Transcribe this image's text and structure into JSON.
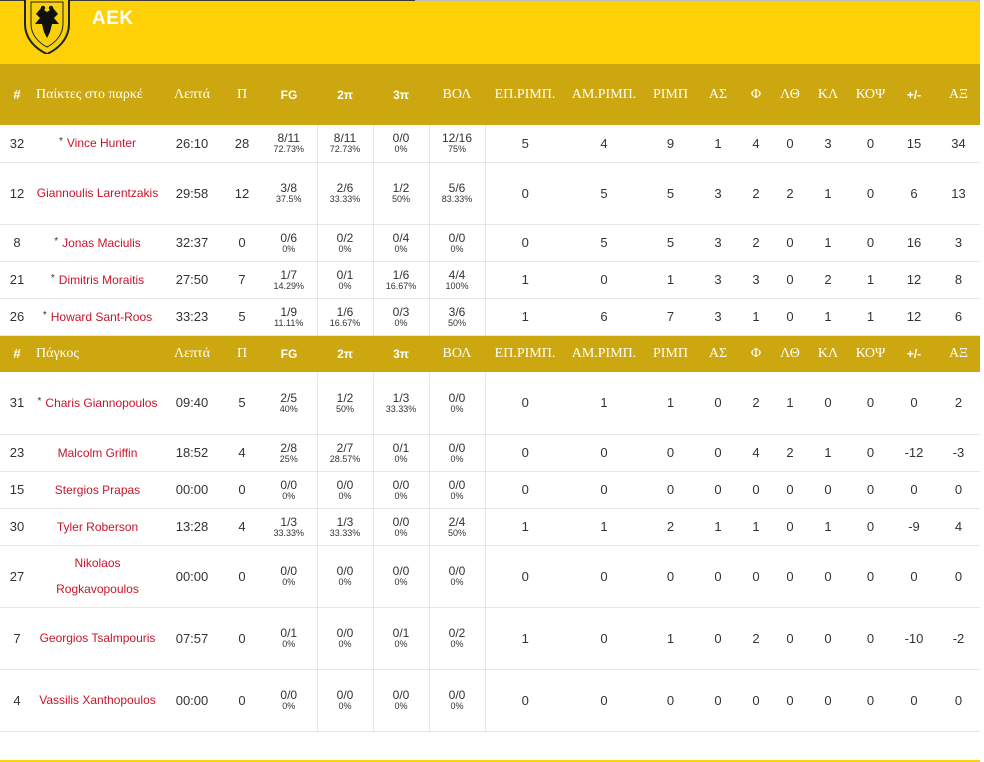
{
  "team": {
    "name": "ΑΕΚ",
    "logo_text": "ΑΕΚ"
  },
  "columns": [
    "Λεπτά",
    "Π",
    "FG",
    "2π",
    "3π",
    "ΒΟΛ",
    "ΕΠ.ΡΙΜΠ.",
    "ΑΜ.ΡΙΜΠ.",
    "ΡΙΜΠ",
    "ΑΣ",
    "Φ",
    "ΛΘ",
    "ΚΛ",
    "ΚΟΨ",
    "+/-",
    "ΑΞ"
  ],
  "starters": {
    "num_label": "#",
    "title": "Παίκτες στο παρκέ",
    "players": [
      {
        "num": "32",
        "starter": true,
        "name": "Vince Hunter",
        "min": "26:10",
        "pts": "28",
        "fg": "8/11",
        "fg_p": "72.73%",
        "p2": "8/11",
        "p2_p": "72.73%",
        "p3": "0/0",
        "p3_p": "0%",
        "ft": "12/16",
        "ft_p": "75%",
        "oreb": "5",
        "dreb": "4",
        "reb": "9",
        "ast": "1",
        "pf": "4",
        "to": "0",
        "stl": "3",
        "blk": "0",
        "pm": "15",
        "eff": "34"
      },
      {
        "num": "12",
        "starter": false,
        "name": "Giannoulis Larentzakis",
        "min": "29:58",
        "pts": "12",
        "fg": "3/8",
        "fg_p": "37.5%",
        "p2": "2/6",
        "p2_p": "33.33%",
        "p3": "1/2",
        "p3_p": "50%",
        "ft": "5/6",
        "ft_p": "83.33%",
        "oreb": "0",
        "dreb": "5",
        "reb": "5",
        "ast": "3",
        "pf": "2",
        "to": "2",
        "stl": "1",
        "blk": "0",
        "pm": "6",
        "eff": "13"
      },
      {
        "num": "8",
        "starter": true,
        "name": "Jonas Maciulis",
        "min": "32:37",
        "pts": "0",
        "fg": "0/6",
        "fg_p": "0%",
        "p2": "0/2",
        "p2_p": "0%",
        "p3": "0/4",
        "p3_p": "0%",
        "ft": "0/0",
        "ft_p": "0%",
        "oreb": "0",
        "dreb": "5",
        "reb": "5",
        "ast": "3",
        "pf": "2",
        "to": "0",
        "stl": "1",
        "blk": "0",
        "pm": "16",
        "eff": "3"
      },
      {
        "num": "21",
        "starter": true,
        "name": "Dimitris Moraitis",
        "min": "27:50",
        "pts": "7",
        "fg": "1/7",
        "fg_p": "14.29%",
        "p2": "0/1",
        "p2_p": "0%",
        "p3": "1/6",
        "p3_p": "16.67%",
        "ft": "4/4",
        "ft_p": "100%",
        "oreb": "1",
        "dreb": "0",
        "reb": "1",
        "ast": "3",
        "pf": "3",
        "to": "0",
        "stl": "2",
        "blk": "1",
        "pm": "12",
        "eff": "8"
      },
      {
        "num": "26",
        "starter": true,
        "name": "Howard Sant-Roos",
        "min": "33:23",
        "pts": "5",
        "fg": "1/9",
        "fg_p": "11.11%",
        "p2": "1/6",
        "p2_p": "16.67%",
        "p3": "0/3",
        "p3_p": "0%",
        "ft": "3/6",
        "ft_p": "50%",
        "oreb": "1",
        "dreb": "6",
        "reb": "7",
        "ast": "3",
        "pf": "1",
        "to": "0",
        "stl": "1",
        "blk": "1",
        "pm": "12",
        "eff": "6"
      }
    ]
  },
  "bench": {
    "num_label": "#",
    "title": "Πάγκος",
    "players": [
      {
        "num": "31",
        "starter": true,
        "name": "Charis Giannopoulos",
        "min": "09:40",
        "pts": "5",
        "fg": "2/5",
        "fg_p": "40%",
        "p2": "1/2",
        "p2_p": "50%",
        "p3": "1/3",
        "p3_p": "33.33%",
        "ft": "0/0",
        "ft_p": "0%",
        "oreb": "0",
        "dreb": "1",
        "reb": "1",
        "ast": "0",
        "pf": "2",
        "to": "1",
        "stl": "0",
        "blk": "0",
        "pm": "0",
        "eff": "2"
      },
      {
        "num": "23",
        "starter": false,
        "name": "Malcolm Griffin",
        "min": "18:52",
        "pts": "4",
        "fg": "2/8",
        "fg_p": "25%",
        "p2": "2/7",
        "p2_p": "28.57%",
        "p3": "0/1",
        "p3_p": "0%",
        "ft": "0/0",
        "ft_p": "0%",
        "oreb": "0",
        "dreb": "0",
        "reb": "0",
        "ast": "0",
        "pf": "4",
        "to": "2",
        "stl": "1",
        "blk": "0",
        "pm": "-12",
        "eff": "-3"
      },
      {
        "num": "15",
        "starter": false,
        "name": "Stergios Prapas",
        "min": "00:00",
        "pts": "0",
        "fg": "0/0",
        "fg_p": "0%",
        "p2": "0/0",
        "p2_p": "0%",
        "p3": "0/0",
        "p3_p": "0%",
        "ft": "0/0",
        "ft_p": "0%",
        "oreb": "0",
        "dreb": "0",
        "reb": "0",
        "ast": "0",
        "pf": "0",
        "to": "0",
        "stl": "0",
        "blk": "0",
        "pm": "0",
        "eff": "0"
      },
      {
        "num": "30",
        "starter": false,
        "name": "Tyler Roberson",
        "min": "13:28",
        "pts": "4",
        "fg": "1/3",
        "fg_p": "33.33%",
        "p2": "1/3",
        "p2_p": "33.33%",
        "p3": "0/0",
        "p3_p": "0%",
        "ft": "2/4",
        "ft_p": "50%",
        "oreb": "1",
        "dreb": "1",
        "reb": "2",
        "ast": "1",
        "pf": "1",
        "to": "0",
        "stl": "1",
        "blk": "0",
        "pm": "-9",
        "eff": "4"
      },
      {
        "num": "27",
        "starter": false,
        "name": "Nikolaos Rogkavopoulos",
        "min": "00:00",
        "pts": "0",
        "fg": "0/0",
        "fg_p": "0%",
        "p2": "0/0",
        "p2_p": "0%",
        "p3": "0/0",
        "p3_p": "0%",
        "ft": "0/0",
        "ft_p": "0%",
        "oreb": "0",
        "dreb": "0",
        "reb": "0",
        "ast": "0",
        "pf": "0",
        "to": "0",
        "stl": "0",
        "blk": "0",
        "pm": "0",
        "eff": "0"
      },
      {
        "num": "7",
        "starter": false,
        "name": "Georgios Tsalmpouris",
        "min": "07:57",
        "pts": "0",
        "fg": "0/1",
        "fg_p": "0%",
        "p2": "0/0",
        "p2_p": "0%",
        "p3": "0/1",
        "p3_p": "0%",
        "ft": "0/2",
        "ft_p": "0%",
        "oreb": "1",
        "dreb": "0",
        "reb": "1",
        "ast": "0",
        "pf": "2",
        "to": "0",
        "stl": "0",
        "blk": "0",
        "pm": "-10",
        "eff": "-2"
      },
      {
        "num": "4",
        "starter": false,
        "name": "Vassilis Xanthopoulos",
        "min": "00:00",
        "pts": "0",
        "fg": "0/0",
        "fg_p": "0%",
        "p2": "0/0",
        "p2_p": "0%",
        "p3": "0/0",
        "p3_p": "0%",
        "ft": "0/0",
        "ft_p": "0%",
        "oreb": "0",
        "dreb": "0",
        "reb": "0",
        "ast": "0",
        "pf": "0",
        "to": "0",
        "stl": "0",
        "blk": "0",
        "pm": "0",
        "eff": "0"
      }
    ]
  }
}
